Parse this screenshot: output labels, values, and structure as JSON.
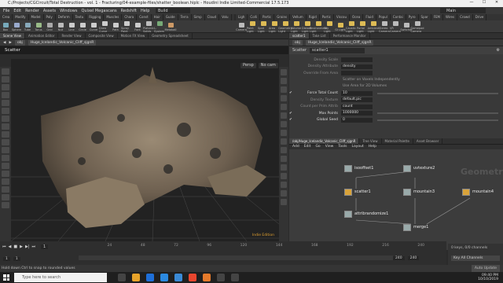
{
  "window": {
    "title": "C:/Projects/CGCircuit/Total Destruction - vol. 1 - Fracturing/04-example-files/shatter_boolean.hiplc - Houdini Indie Limited-Commercial 17.5.173",
    "buttons": [
      "—",
      "☐",
      "✕"
    ]
  },
  "menu": [
    "File",
    "Edit",
    "Render",
    "Assets",
    "Windows",
    "Quixel Megascans",
    "Redshift",
    "Help"
  ],
  "build_label": "Build",
  "desktop_label": "Main",
  "shelf_tabs_left": [
    "Crea",
    "Modify",
    "Model",
    "Poly",
    "Deform",
    "Textu",
    "Rigging",
    "Muscles",
    "Chara",
    "Const",
    "Hair",
    "Guide",
    "Terra",
    "Simp",
    "Cloud",
    "Volu"
  ],
  "shelf_tabs_right": [
    "Ligh",
    "Colli",
    "Partic",
    "Grains",
    "Vellum",
    "Rigid",
    "Partic",
    "Viscou",
    "Ocea",
    "Fluid",
    "Popul",
    "Contai",
    "Pyro",
    "Spar",
    "FEM",
    "Wires",
    "Crowd",
    "Drive"
  ],
  "tools_left": [
    {
      "label": "Box",
      "color": "#7ab"
    },
    {
      "label": "Sphere",
      "color": "#9ac"
    },
    {
      "label": "Tube",
      "color": "#8ab"
    },
    {
      "label": "Torus",
      "color": "#9b8"
    },
    {
      "label": "Grid",
      "color": "#aaa"
    },
    {
      "label": "Null",
      "color": "#bbb"
    },
    {
      "label": "Line",
      "color": "#ccc"
    },
    {
      "label": "Circle",
      "color": "#ccc"
    },
    {
      "label": "Curve",
      "color": "#ccc"
    },
    {
      "label": "Draw Curve",
      "color": "#ccc"
    },
    {
      "label": "Path",
      "color": "#ccc"
    },
    {
      "label": "Spray Paint",
      "color": "#ccc"
    },
    {
      "label": "Font",
      "color": "#ccc"
    },
    {
      "label": "Platonic Solids",
      "color": "#bbb"
    },
    {
      "label": "L-System",
      "color": "#7a7"
    },
    {
      "label": "Metaball",
      "color": "#c96"
    }
  ],
  "tools_right": [
    {
      "label": "Camera",
      "color": "#bbb"
    },
    {
      "label": "Point Light",
      "color": "#db5"
    },
    {
      "label": "Spot Light",
      "color": "#db5"
    },
    {
      "label": "Area Light",
      "color": "#db5"
    },
    {
      "label": "Geometry Light",
      "color": "#db5"
    },
    {
      "label": "Volume Light",
      "color": "#db5"
    },
    {
      "label": "Distant Light",
      "color": "#db5"
    },
    {
      "label": "Environment Light",
      "color": "#db5"
    },
    {
      "label": "Sky Light",
      "color": "#db5"
    },
    {
      "label": "GI Light",
      "color": "#db5"
    },
    {
      "label": "Caustic Light",
      "color": "#db5"
    },
    {
      "label": "Portal Light",
      "color": "#db5"
    },
    {
      "label": "Ambient Light",
      "color": "#db5"
    },
    {
      "label": "Stereo Camera",
      "color": "#bbb"
    },
    {
      "label": "VR Camera",
      "color": "#bbb"
    },
    {
      "label": "Switcher",
      "color": "#bbb"
    },
    {
      "label": "Gamepad Camera",
      "color": "#bbb"
    }
  ],
  "viewer_tabs": [
    "Scene View",
    "Animation Editor",
    "Render View",
    "Composite View",
    "Motion FX View",
    "Geometry Spreadsheet"
  ],
  "viewer_path": [
    "obj",
    "Huge_Icelandic_Volcanic_Cliff_sjgnR"
  ],
  "viewer_title": "Scatter",
  "persp": "Persp",
  "cam": "No cam",
  "indie": "Indie Edition",
  "param_tabs": [
    "scatter1",
    "Take List",
    "Performance Monitor"
  ],
  "param_path": [
    "obj",
    "Huge_Icelandic_Volcanic_Cliff_sjgnR"
  ],
  "param_node_type": "Scatter",
  "param_node_name": "scatter1",
  "params": [
    {
      "label": "Density Scale",
      "value": "",
      "active": false
    },
    {
      "label": "Density Attribute",
      "value": "density",
      "active": false
    },
    {
      "label": "Override From Area",
      "value": "",
      "active": false
    },
    {
      "label": "",
      "value": "Scatter on Voxels Independently",
      "active": false
    },
    {
      "label": "",
      "value": "Use Area for 2D Volumes",
      "active": false
    },
    {
      "label": "Force Total Count",
      "value": "10",
      "active": true
    },
    {
      "label": "Density Texture",
      "value": "default.pic",
      "active": false
    },
    {
      "label": "Count per Prim Attrib",
      "value": "count",
      "active": false
    },
    {
      "label": "Max Points",
      "value": "1000000",
      "active": true
    },
    {
      "label": "Global Seed",
      "value": "0",
      "active": true
    }
  ],
  "net_tabs": [
    "/obj/Huge_Icelandic_Volcanic_Cliff_sjgnR",
    "Tree View",
    "Material Palette",
    "Asset Browser"
  ],
  "net_menu": [
    "Add",
    "Edit",
    "Go",
    "View",
    "Tools",
    "Layout",
    "Help"
  ],
  "net_watermark": "Geometry",
  "nodes": [
    {
      "name": "isooffset1",
      "kind": "g"
    },
    {
      "name": "uvtexture2",
      "kind": "g"
    },
    {
      "name": "scatter1",
      "kind": "y"
    },
    {
      "name": "mountain3",
      "kind": "g"
    },
    {
      "name": "mountain4",
      "kind": "y"
    },
    {
      "name": "attribrandomize1",
      "kind": "g"
    },
    {
      "name": "merge1",
      "kind": "g"
    }
  ],
  "timeline": {
    "frame": "1",
    "start": "1",
    "end": "1",
    "range_end": "240",
    "range_end2": "240",
    "ticks": [
      "",
      "24",
      "48",
      "72",
      "96",
      "120",
      "144",
      "168",
      "192",
      "216",
      "240"
    ]
  },
  "keys_info": "0 keys, 0/0 channels",
  "key_all": "Key All Channels",
  "auto_update": "Auto Update",
  "status": "Hold down Ctrl to snap to rounded values",
  "taskbar": {
    "search": "Type here to search",
    "time": "09:40 PM",
    "date": "10/10/2019"
  }
}
